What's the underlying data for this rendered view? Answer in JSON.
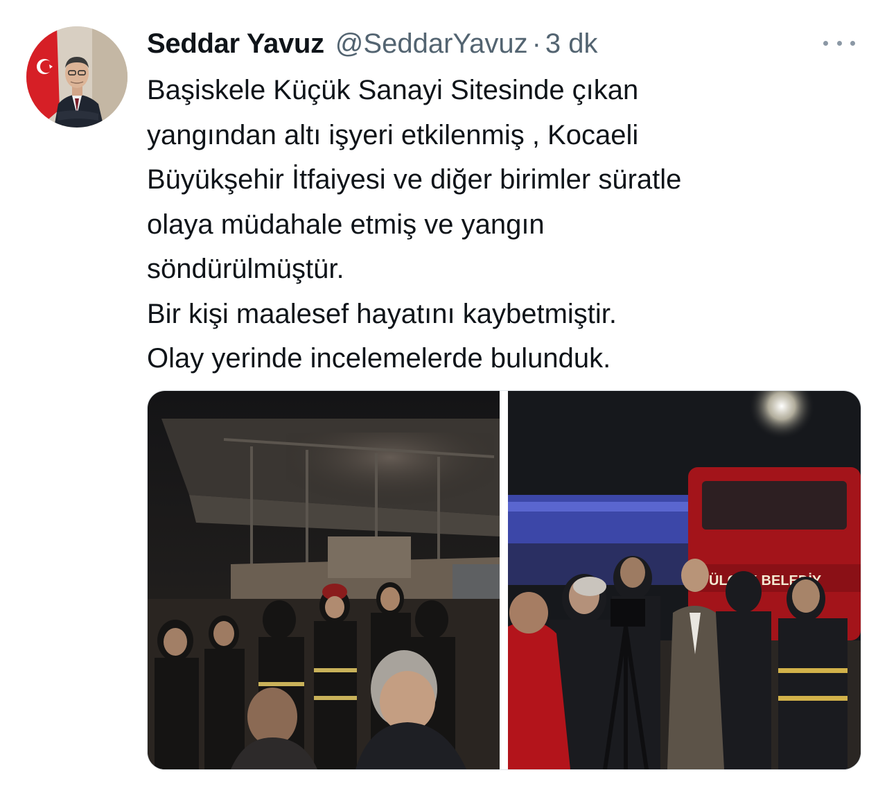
{
  "tweet": {
    "author_name": "Seddar Yavuz",
    "author_handle": "@SeddarYavuz",
    "separator": "·",
    "time": "3 dk",
    "text_lines": [
      "Başiskele Küçük Sanayi Sitesinde çıkan",
      "yangından altı işyeri etkilenmiş , Kocaeli",
      "Büyükşehir İtfaiyesi ve diğer birimler süratle",
      "olaya müdahale etmiş ve yangın",
      "söndürülmüştür.",
      "Bir kişi maalesef hayatını kaybetmiştir.",
      "Olay yerinde incelemelerde bulunduk."
    ],
    "media": {
      "photo_2_truck_sign": "ÜLCÜK BELEDİY"
    }
  },
  "icons": {
    "more": "more-horizontal-icon",
    "avatar_flag": "turkish-flag"
  },
  "colors": {
    "name": "#0f1419",
    "secondary": "#536471",
    "fire_truck": "#a3141a",
    "night_sky": "#16181c"
  }
}
